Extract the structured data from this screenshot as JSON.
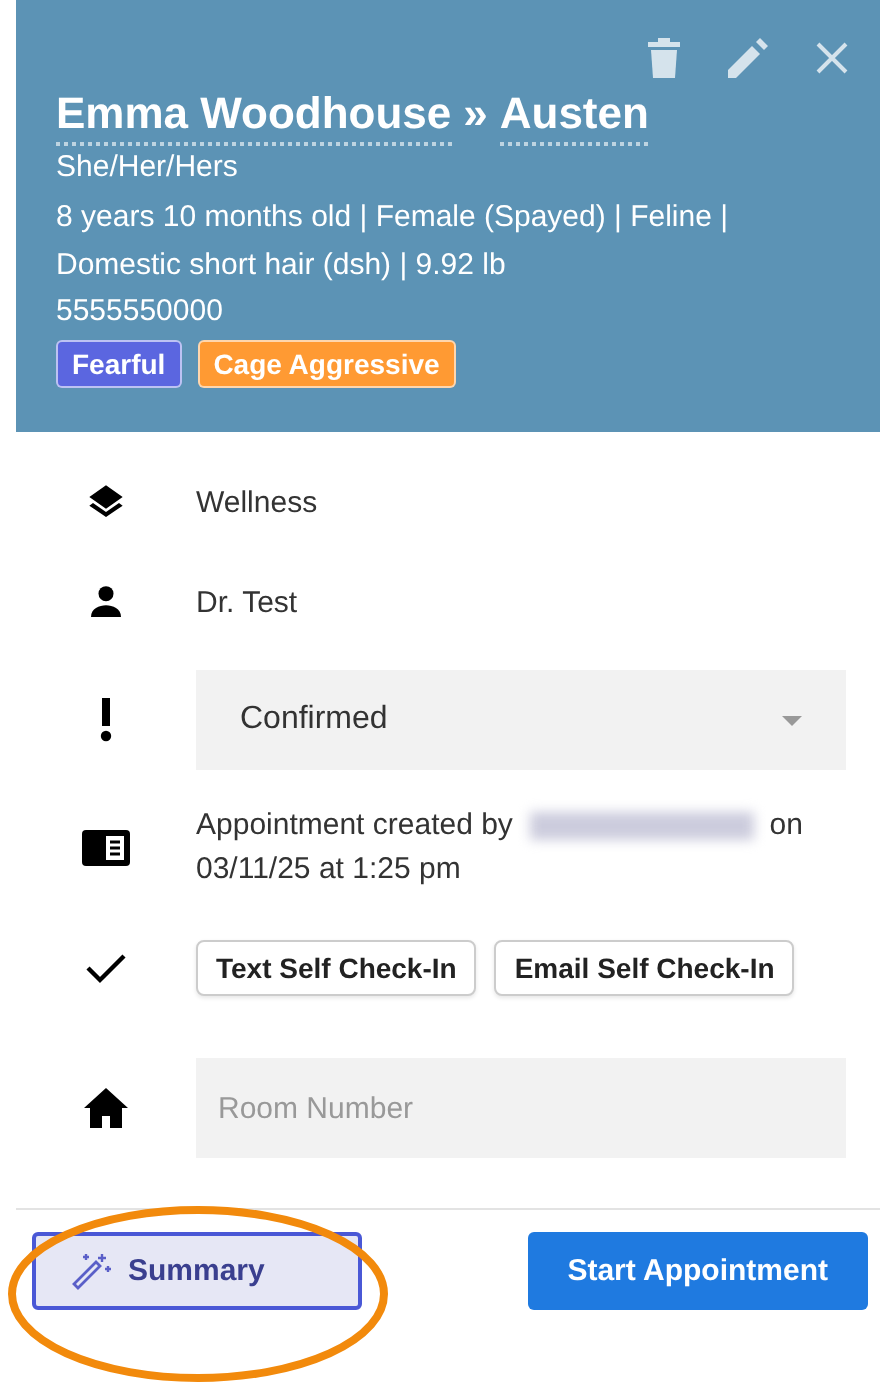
{
  "header": {
    "patient": "Emma Woodhouse",
    "separator": "»",
    "owner": "Austen",
    "pronouns": "She/Her/Hers",
    "details": "8 years 10 months old | Female (Spayed) | Feline | Domestic short hair (dsh) | 9.92 lb",
    "phone": "5555550000",
    "tags": [
      {
        "label": "Fearful",
        "color": "#5b66e0"
      },
      {
        "label": "Cage Aggressive",
        "color": "#ff9a33"
      }
    ]
  },
  "rows": [
    {
      "kind": "text",
      "text": "Wellness"
    },
    {
      "kind": "text",
      "text": "Dr. Test"
    },
    {
      "kind": "select",
      "value": "Confirmed"
    },
    {
      "kind": "note",
      "before": "Appointment created by",
      "after": "on 03/11/25 at 1:25 pm"
    },
    {
      "kind": "buttons",
      "buttons": [
        "Text Self Check-In",
        "Email Self Check-In"
      ]
    },
    {
      "kind": "input",
      "placeholder": "Room Number"
    }
  ],
  "footer": {
    "summary": {
      "label": "Summary",
      "highlighted": true
    },
    "start": "Start Appointment"
  }
}
